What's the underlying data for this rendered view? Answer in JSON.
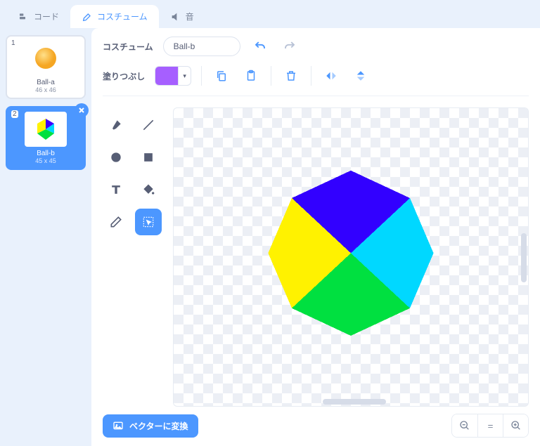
{
  "tabs": {
    "code": "コード",
    "costumes": "コスチューム",
    "sounds": "音"
  },
  "costumes": [
    {
      "num": "1",
      "name": "Ball-a",
      "dims": "46 x 46"
    },
    {
      "num": "2",
      "name": "Ball-b",
      "dims": "45 x 45"
    }
  ],
  "editor": {
    "costume_label": "コスチューム",
    "costume_name": "Ball-b",
    "fill_label": "塗りつぶし",
    "fill_color": "#a65fff",
    "convert_label": "ベクターに変換"
  },
  "icons": {
    "undo": "undo-icon",
    "redo": "redo-icon",
    "copy": "copy-icon",
    "paste": "paste-icon",
    "trash": "trash-icon",
    "flip_h": "flip-horizontal-icon",
    "flip_v": "flip-vertical-icon",
    "brush": "brush-icon",
    "line": "line-icon",
    "circle": "circle-icon",
    "square": "square-icon",
    "text": "text-icon",
    "fill": "fill-bucket-icon",
    "erase": "eraser-icon",
    "select": "select-icon",
    "zoom_out": "zoom-out-icon",
    "zoom_reset": "zoom-reset-icon",
    "zoom_in": "zoom-in-icon",
    "image": "image-icon",
    "close": "close-icon"
  }
}
